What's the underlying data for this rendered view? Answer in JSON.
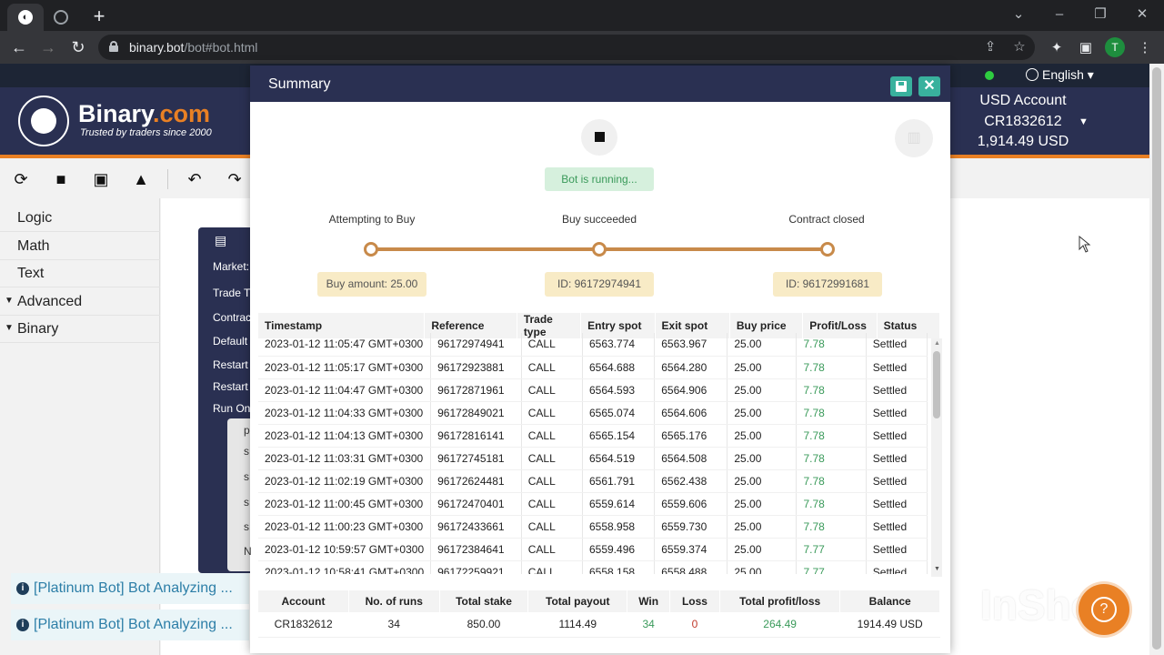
{
  "browser": {
    "url_host": "binary.bot",
    "url_path": "/bot#bot.html",
    "profile_initial": "T"
  },
  "site": {
    "language": "English",
    "logo_main": "Binary",
    "logo_suffix": ".com",
    "tagline": "Trusted by traders since 2000",
    "account_title": "USD Account",
    "account_id": "CR1832612",
    "account_balance": "1,914.49 USD"
  },
  "toolbox": {
    "categories": [
      {
        "label": "Logic",
        "expandable": false
      },
      {
        "label": "Math",
        "expandable": false
      },
      {
        "label": "Text",
        "expandable": false
      },
      {
        "label": "Advanced",
        "expandable": true
      },
      {
        "label": "Binary",
        "expandable": true
      }
    ]
  },
  "workspace": {
    "block_labels": [
      "Market:",
      "Trade T",
      "Contrac",
      "Default",
      "Restart",
      "Restart",
      "Run On"
    ],
    "sub_labels": [
      "p",
      "s",
      "s",
      "s",
      "s",
      "N"
    ]
  },
  "notifications": [
    "[Platinum Bot] Bot Analyzing ...",
    "[Platinum Bot] Bot Analyzing ..."
  ],
  "summary": {
    "title": "Summary",
    "status": "Bot is running...",
    "stages": [
      {
        "label": "Attempting to Buy",
        "info": "Buy amount: 25.00"
      },
      {
        "label": "Buy succeeded",
        "info": "ID: 96172974941"
      },
      {
        "label": "Contract closed",
        "info": "ID: 96172991681"
      }
    ],
    "columns": [
      "Timestamp",
      "Reference",
      "Trade type",
      "Entry spot",
      "Exit spot",
      "Buy price",
      "Profit/Loss",
      "Status"
    ],
    "trades": [
      [
        "2023-01-12 11:05:47 GMT+0300",
        "96172974941",
        "CALL",
        "6563.774",
        "6563.967",
        "25.00",
        "7.78",
        "Settled"
      ],
      [
        "2023-01-12 11:05:17 GMT+0300",
        "96172923881",
        "CALL",
        "6564.688",
        "6564.280",
        "25.00",
        "7.78",
        "Settled"
      ],
      [
        "2023-01-12 11:04:47 GMT+0300",
        "96172871961",
        "CALL",
        "6564.593",
        "6564.906",
        "25.00",
        "7.78",
        "Settled"
      ],
      [
        "2023-01-12 11:04:33 GMT+0300",
        "96172849021",
        "CALL",
        "6565.074",
        "6564.606",
        "25.00",
        "7.78",
        "Settled"
      ],
      [
        "2023-01-12 11:04:13 GMT+0300",
        "96172816141",
        "CALL",
        "6565.154",
        "6565.176",
        "25.00",
        "7.78",
        "Settled"
      ],
      [
        "2023-01-12 11:03:31 GMT+0300",
        "96172745181",
        "CALL",
        "6564.519",
        "6564.508",
        "25.00",
        "7.78",
        "Settled"
      ],
      [
        "2023-01-12 11:02:19 GMT+0300",
        "96172624481",
        "CALL",
        "6561.791",
        "6562.438",
        "25.00",
        "7.78",
        "Settled"
      ],
      [
        "2023-01-12 11:00:45 GMT+0300",
        "96172470401",
        "CALL",
        "6559.614",
        "6559.606",
        "25.00",
        "7.78",
        "Settled"
      ],
      [
        "2023-01-12 11:00:23 GMT+0300",
        "96172433661",
        "CALL",
        "6558.958",
        "6559.730",
        "25.00",
        "7.78",
        "Settled"
      ],
      [
        "2023-01-12 10:59:57 GMT+0300",
        "96172384641",
        "CALL",
        "6559.496",
        "6559.374",
        "25.00",
        "7.77",
        "Settled"
      ],
      [
        "2023-01-12 10:58:41 GMT+0300",
        "96172259921",
        "CALL",
        "6558.158",
        "6558.488",
        "25.00",
        "7.77",
        "Settled"
      ]
    ],
    "totals_columns": [
      "Account",
      "No. of runs",
      "Total stake",
      "Total payout",
      "Win",
      "Loss",
      "Total profit/loss",
      "Balance"
    ],
    "totals": [
      "CR1832612",
      "34",
      "850.00",
      "1114.49",
      "34",
      "0",
      "264.49",
      "1914.49 USD"
    ]
  },
  "watermark": "InShot",
  "colors": {
    "header_navy": "#2a3052",
    "accent_orange": "#e98024",
    "teal_button": "#39b19d",
    "profit_green": "#3a9a5a",
    "loss_red": "#c0392b"
  }
}
